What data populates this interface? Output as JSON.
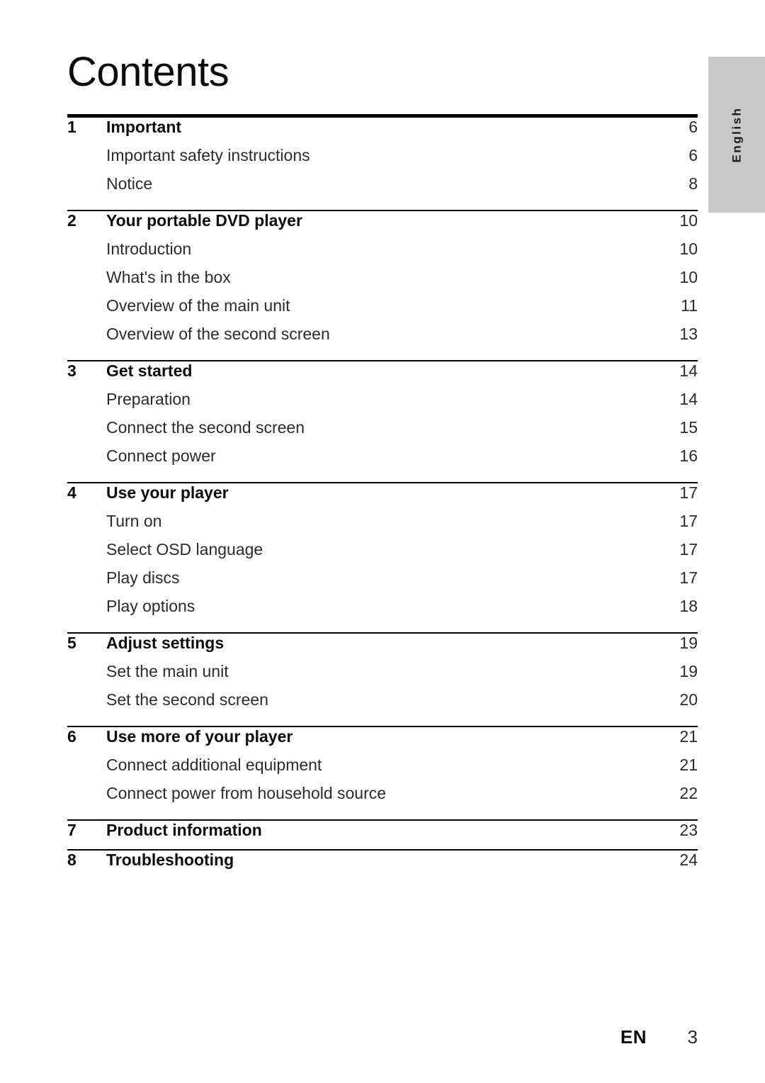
{
  "page": {
    "title": "Contents",
    "side_tab_label": "English",
    "side_tab_color": "#c8c8c8"
  },
  "toc": {
    "sections": [
      {
        "number": "1",
        "title": "Important",
        "page": "6",
        "entries": [
          {
            "label": "Important safety instructions",
            "page": "6"
          },
          {
            "label": "Notice",
            "page": "8"
          }
        ]
      },
      {
        "number": "2",
        "title": "Your portable DVD player",
        "page": "10",
        "entries": [
          {
            "label": "Introduction",
            "page": "10"
          },
          {
            "label": "What's in the box",
            "page": "10"
          },
          {
            "label": "Overview of the main unit",
            "page": "11"
          },
          {
            "label": "Overview of the second screen",
            "page": "13"
          }
        ]
      },
      {
        "number": "3",
        "title": "Get started",
        "page": "14",
        "entries": [
          {
            "label": "Preparation",
            "page": "14"
          },
          {
            "label": "Connect the second screen",
            "page": "15"
          },
          {
            "label": "Connect power",
            "page": "16"
          }
        ]
      },
      {
        "number": "4",
        "title": "Use your player",
        "page": "17",
        "entries": [
          {
            "label": "Turn on",
            "page": "17"
          },
          {
            "label": "Select OSD language",
            "page": "17"
          },
          {
            "label": "Play discs",
            "page": "17"
          },
          {
            "label": "Play options",
            "page": "18"
          }
        ]
      },
      {
        "number": "5",
        "title": "Adjust settings",
        "page": "19",
        "entries": [
          {
            "label": "Set the main unit",
            "page": "19"
          },
          {
            "label": "Set the second screen",
            "page": "20"
          }
        ]
      },
      {
        "number": "6",
        "title": "Use more of your player",
        "page": "21",
        "entries": [
          {
            "label": "Connect additional equipment",
            "page": "21"
          },
          {
            "label": "Connect power from household source",
            "page": "22"
          }
        ]
      },
      {
        "number": "7",
        "title": "Product information",
        "page": "23",
        "entries": []
      },
      {
        "number": "8",
        "title": "Troubleshooting",
        "page": "24",
        "entries": []
      }
    ]
  },
  "footer": {
    "language_code": "EN",
    "page_number": "3"
  }
}
